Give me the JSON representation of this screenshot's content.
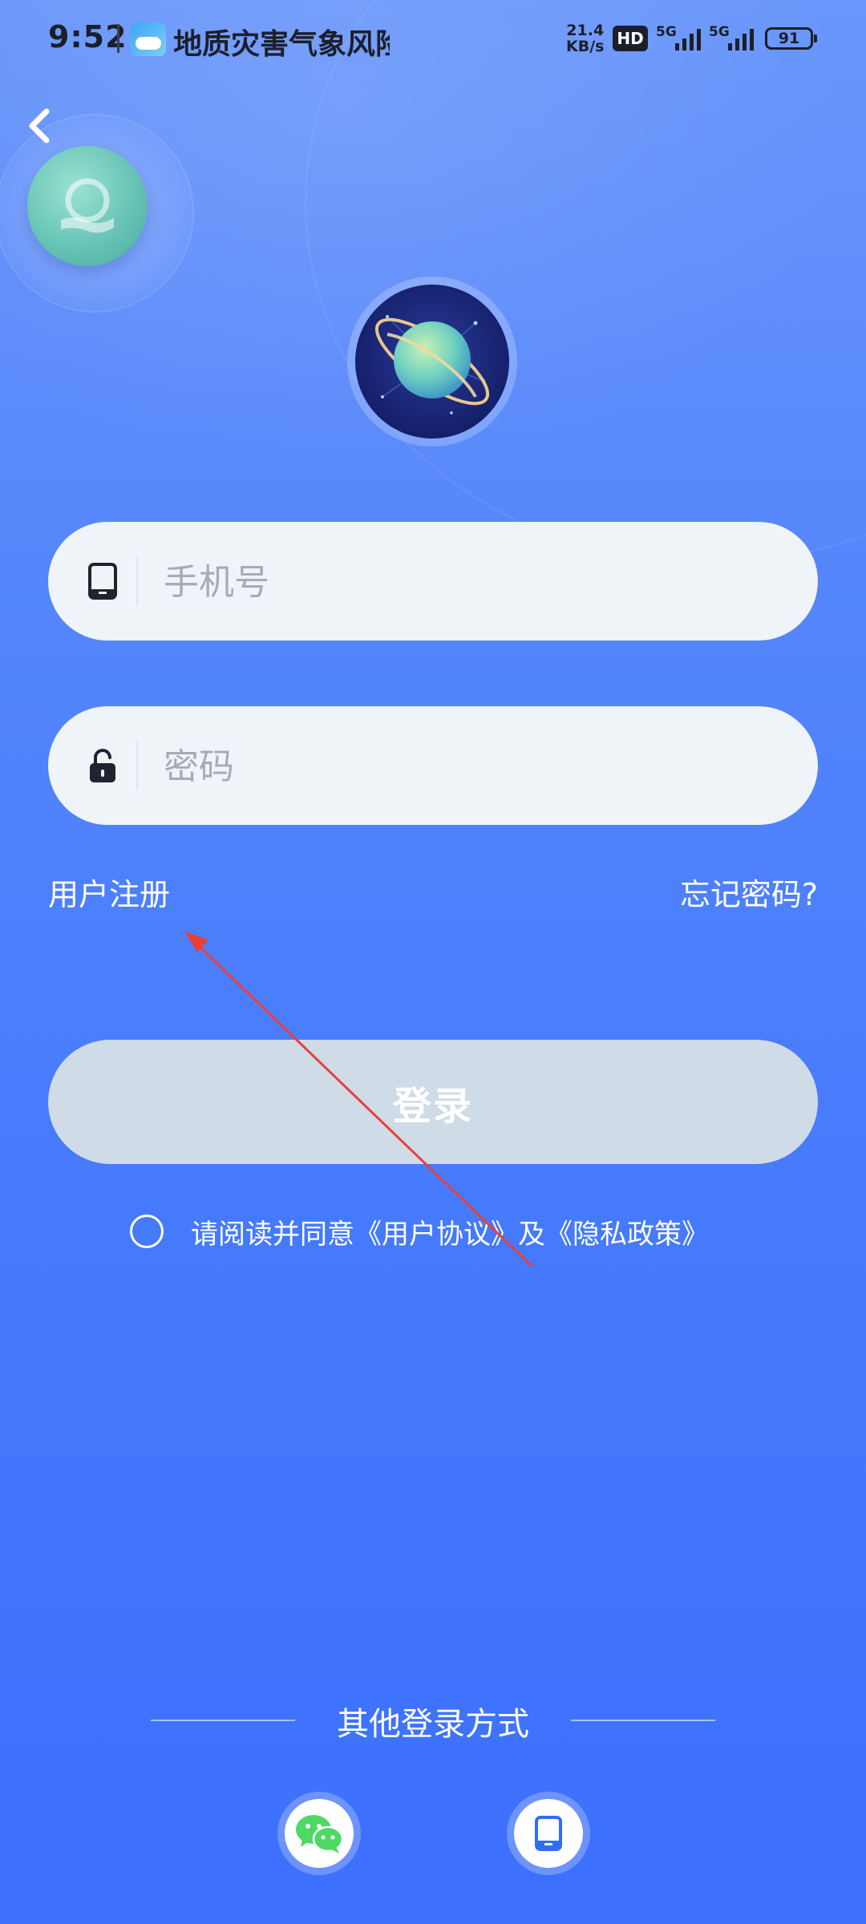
{
  "status_bar": {
    "time": "9:52",
    "app_name": "地质灾害气象风险",
    "net_speed_value": "21.4",
    "net_speed_unit": "KB/s",
    "hd_label": "HD",
    "signal_1_label": "5G",
    "signal_2_label": "5G",
    "battery": "91"
  },
  "icons": {
    "back": "chevron-left-icon",
    "phone": "phone-icon",
    "lock": "lock-icon",
    "wechat": "wechat-icon"
  },
  "login_form": {
    "phone_placeholder": "手机号",
    "password_placeholder": "密码",
    "phone_value": "",
    "password_value": ""
  },
  "links": {
    "register": "用户注册",
    "forgot_password": "忘记密码?"
  },
  "login_button": "登录",
  "agreement": {
    "prefix": "请阅读并同意",
    "user_agreement": "《用户协议》",
    "conjunction": "及",
    "privacy_policy": "《隐私政策》"
  },
  "other_login": {
    "title": "其他登录方式"
  },
  "colors": {
    "background_top": "#6a97fb",
    "background_bottom": "#3c70fd",
    "input_bg": "#eff4f9",
    "login_button_bg": "#cfdbe7",
    "annotation_arrow": "#e8403a",
    "wechat_green": "#4cd964"
  }
}
